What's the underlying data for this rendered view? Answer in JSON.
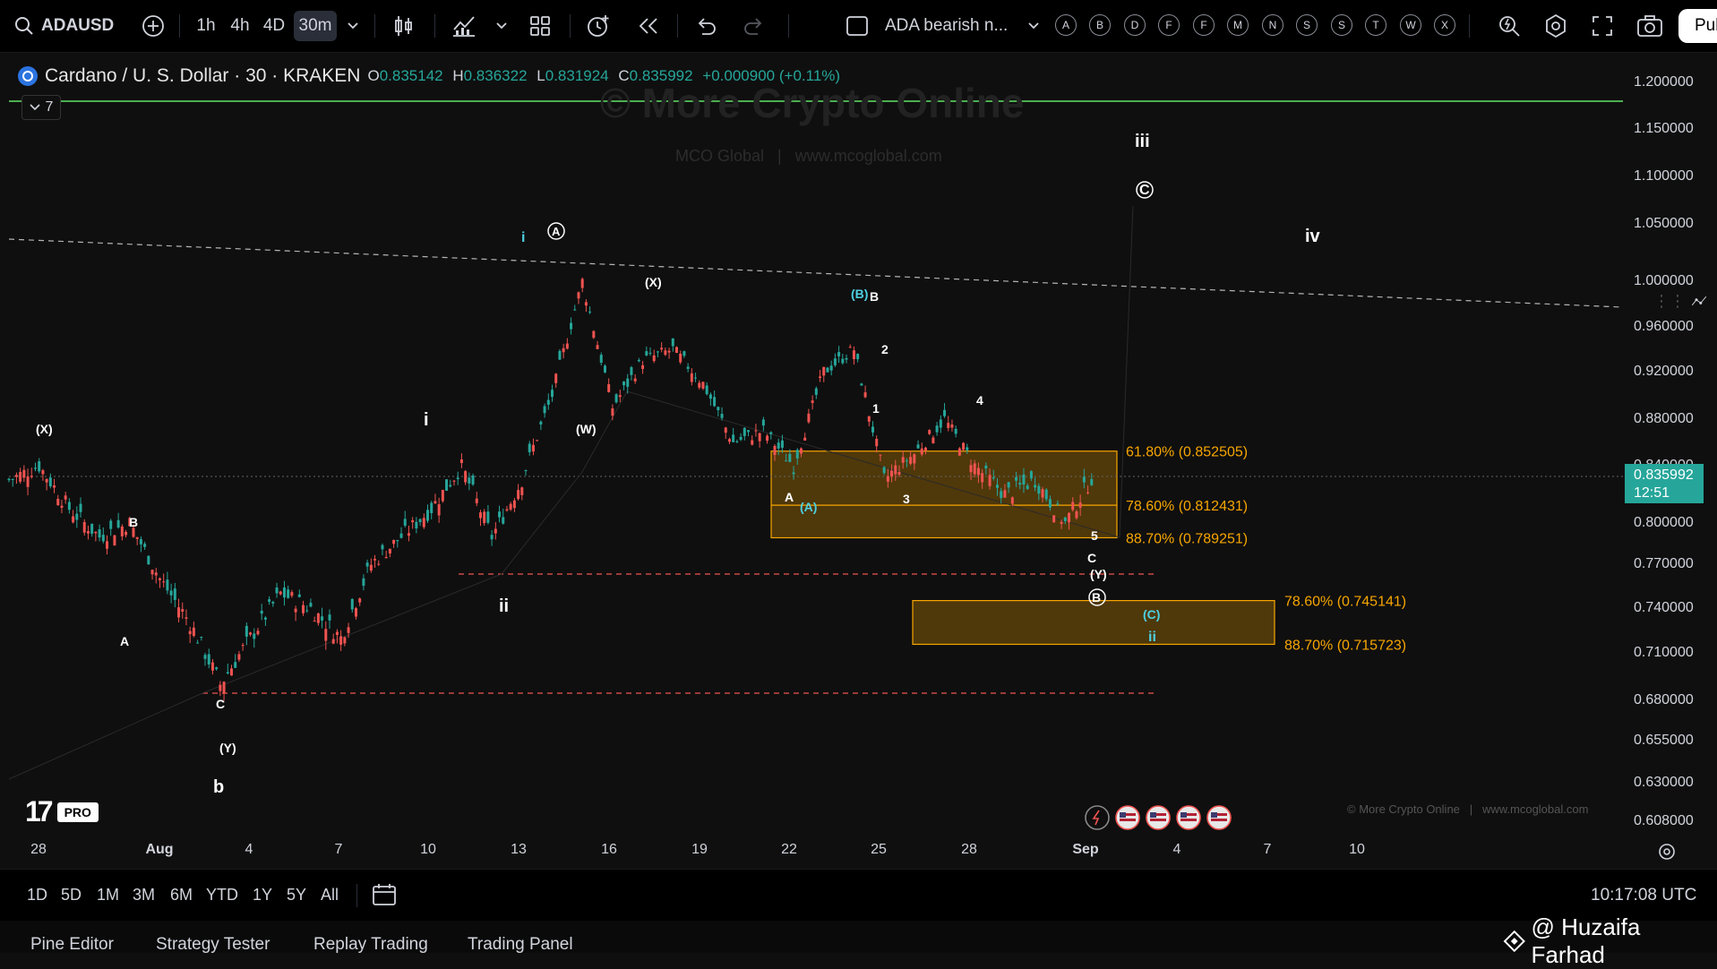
{
  "toolbar": {
    "symbol": "ADAUSD",
    "intervals": [
      "1h",
      "4h",
      "4D",
      "30m"
    ],
    "active_interval": "30m",
    "layout_name": "ADA bearish n...",
    "alert_letters": [
      "A",
      "B",
      "D",
      "F",
      "F",
      "M",
      "N",
      "S",
      "S",
      "T",
      "W",
      "X"
    ],
    "publish_label": "Pub",
    "icons": [
      "search-icon",
      "add-symbol-icon",
      "chevron-down-icon",
      "bar-style-icon",
      "indicators-icon",
      "templates-icon",
      "alert-icon",
      "replay-icon",
      "undo-icon",
      "redo-icon",
      "layout-icon",
      "quick-search-icon",
      "settings-icon",
      "fullscreen-icon",
      "screenshot-icon"
    ]
  },
  "legend": {
    "title": "Cardano / U. S. Dollar · 30 · KRAKEN",
    "open_label": "O",
    "open": "0.835142",
    "high_label": "H",
    "high": "0.836322",
    "low_label": "L",
    "low": "0.831924",
    "close_label": "C",
    "close": "0.835992",
    "change": "+0.000900 (+0.11%)",
    "indicator_count": "7"
  },
  "watermark": {
    "title": "© More Crypto Online",
    "subtitle": "MCO Global   |   www.mcoglobal.com",
    "footer": "© More Crypto Online   |   www.mcoglobal.com"
  },
  "chart_data": {
    "type": "line",
    "symbol": "ADAUSD",
    "interval": "30m",
    "exchange": "KRAKEN",
    "x_ticks": [
      "28",
      "Aug",
      "4",
      "7",
      "10",
      "13",
      "16",
      "19",
      "22",
      "25",
      "28",
      "Sep",
      "4",
      "7",
      "10"
    ],
    "y_ticks": [
      "1.200000",
      "1.150000",
      "1.100000",
      "1.050000",
      "1.000000",
      "0.960000",
      "0.920000",
      "0.880000",
      "0.840000",
      "0.800000",
      "0.770000",
      "0.740000",
      "0.710000",
      "0.680000",
      "0.655000",
      "0.630000",
      "0.608000"
    ],
    "last_price": "0.835992",
    "countdown": "12:51",
    "series": [
      {
        "x": [
          "Jul 27",
          "Jul 28",
          "Jul 29",
          "Jul 30",
          "Jul 31",
          "Aug 1",
          "Aug 2",
          "Aug 3",
          "Aug 4",
          "Aug 5",
          "Aug 6",
          "Aug 7",
          "Aug 8",
          "Aug 9",
          "Aug 10",
          "Aug 11",
          "Aug 12",
          "Aug 13",
          "Aug 14",
          "Aug 15",
          "Aug 16",
          "Aug 17",
          "Aug 18",
          "Aug 19",
          "Aug 20",
          "Aug 21",
          "Aug 22",
          "Aug 23",
          "Aug 24",
          "Aug 25",
          "Aug 26",
          "Aug 27",
          "Aug 28",
          "Aug 29",
          "Aug 30",
          "Aug 31",
          "Sep 1"
        ],
        "y": [
          0.83,
          0.84,
          0.81,
          0.79,
          0.8,
          0.76,
          0.73,
          0.69,
          0.72,
          0.75,
          0.74,
          0.72,
          0.77,
          0.79,
          0.81,
          0.84,
          0.79,
          0.83,
          0.9,
          1.0,
          0.89,
          0.93,
          0.94,
          0.91,
          0.86,
          0.87,
          0.84,
          0.92,
          0.94,
          0.83,
          0.85,
          0.88,
          0.84,
          0.82,
          0.83,
          0.8,
          0.836
        ]
      }
    ],
    "fib_levels": [
      {
        "label": "61.80% (0.852505)",
        "value": 0.852505
      },
      {
        "label": "78.60% (0.812431)",
        "value": 0.812431
      },
      {
        "label": "88.70% (0.789251)",
        "value": 0.789251
      },
      {
        "label": "78.60% (0.745141)",
        "value": 0.745141
      },
      {
        "label": "88.70% (0.715723)",
        "value": 0.715723
      }
    ],
    "wave_labels": [
      "(X)",
      "B",
      "A",
      "C",
      "(Y)",
      "b",
      "i",
      "ii",
      "i",
      "A",
      "(W)",
      "(X)",
      "(B)",
      "B",
      "2",
      "1",
      "4",
      "A",
      "(A)",
      "3",
      "5",
      "C",
      "(Y)",
      "B",
      "(C)",
      "ii",
      "iii",
      "C",
      "iv"
    ]
  },
  "range_bar": {
    "ranges": [
      "1D",
      "5D",
      "1M",
      "3M",
      "6M",
      "YTD",
      "1Y",
      "5Y",
      "All"
    ],
    "clock": "10:17:08 UTC"
  },
  "panel_tabs": [
    "Pine Editor",
    "Strategy Tester",
    "Replay Trading",
    "Trading Panel"
  ],
  "credit": "@ Huzaifa Farhad",
  "logo_badge": "PRO",
  "colors": {
    "up": "#26a69a",
    "down": "#ef5350",
    "accent": "#f7a600",
    "green_line": "#4caf50",
    "background": "#0f0f0f"
  }
}
